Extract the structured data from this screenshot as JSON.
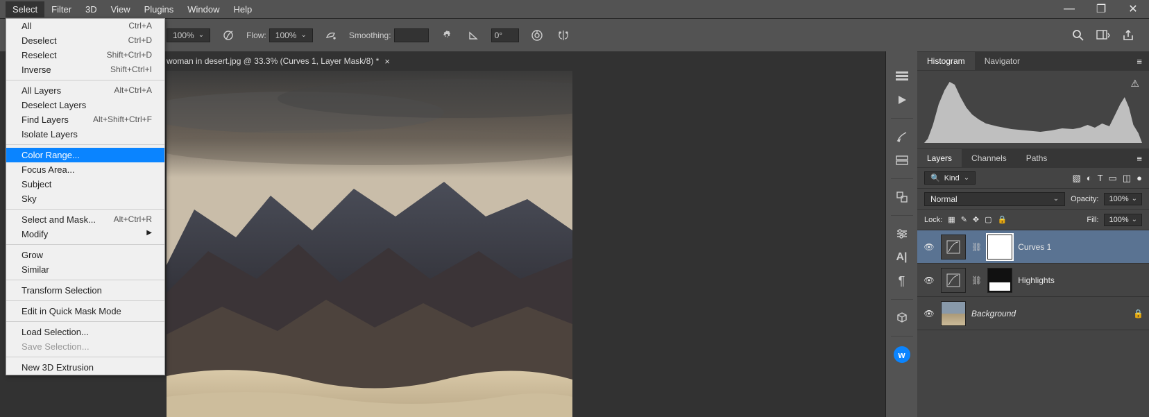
{
  "menubar": {
    "items": [
      "Select",
      "Filter",
      "3D",
      "View",
      "Plugins",
      "Window",
      "Help"
    ]
  },
  "dropdown": {
    "groups": [
      [
        {
          "label": "All",
          "shortcut": "Ctrl+A"
        },
        {
          "label": "Deselect",
          "shortcut": "Ctrl+D"
        },
        {
          "label": "Reselect",
          "shortcut": "Shift+Ctrl+D"
        },
        {
          "label": "Inverse",
          "shortcut": "Shift+Ctrl+I"
        }
      ],
      [
        {
          "label": "All Layers",
          "shortcut": "Alt+Ctrl+A"
        },
        {
          "label": "Deselect Layers",
          "shortcut": ""
        },
        {
          "label": "Find Layers",
          "shortcut": "Alt+Shift+Ctrl+F"
        },
        {
          "label": "Isolate Layers",
          "shortcut": ""
        }
      ],
      [
        {
          "label": "Color Range...",
          "shortcut": "",
          "highlighted": true
        },
        {
          "label": "Focus Area...",
          "shortcut": ""
        },
        {
          "label": "Subject",
          "shortcut": ""
        },
        {
          "label": "Sky",
          "shortcut": ""
        }
      ],
      [
        {
          "label": "Select and Mask...",
          "shortcut": "Alt+Ctrl+R"
        },
        {
          "label": "Modify",
          "shortcut": "",
          "submenu": true
        }
      ],
      [
        {
          "label": "Grow",
          "shortcut": ""
        },
        {
          "label": "Similar",
          "shortcut": ""
        }
      ],
      [
        {
          "label": "Transform Selection",
          "shortcut": ""
        }
      ],
      [
        {
          "label": "Edit in Quick Mask Mode",
          "shortcut": ""
        }
      ],
      [
        {
          "label": "Load Selection...",
          "shortcut": ""
        },
        {
          "label": "Save Selection...",
          "shortcut": "",
          "disabled": true
        }
      ],
      [
        {
          "label": "New 3D Extrusion",
          "shortcut": ""
        }
      ]
    ]
  },
  "optionsbar": {
    "opacity": "100%",
    "flow_label": "Flow:",
    "flow": "100%",
    "smoothing_label": "Smoothing:",
    "angle": "0°"
  },
  "document": {
    "tab_title": "woman in desert.jpg @ 33.3% (Curves 1, Layer Mask/8) *"
  },
  "histogram_panel": {
    "tabs": [
      "Histogram",
      "Navigator"
    ],
    "active": 0
  },
  "layers_panel": {
    "tabs": [
      "Layers",
      "Channels",
      "Paths"
    ],
    "active": 0,
    "kind_label": "Kind",
    "blend_mode": "Normal",
    "opacity_label": "Opacity:",
    "opacity": "100%",
    "lock_label": "Lock:",
    "fill_label": "Fill:",
    "fill": "100%",
    "layers": [
      {
        "name": "Curves 1",
        "type": "adjustment",
        "mask": "white",
        "selected": true
      },
      {
        "name": "Highlights",
        "type": "adjustment",
        "mask": "mixed"
      },
      {
        "name": "Background",
        "type": "image",
        "locked": true,
        "italic": true
      }
    ]
  },
  "icons": {
    "search": "Q"
  }
}
